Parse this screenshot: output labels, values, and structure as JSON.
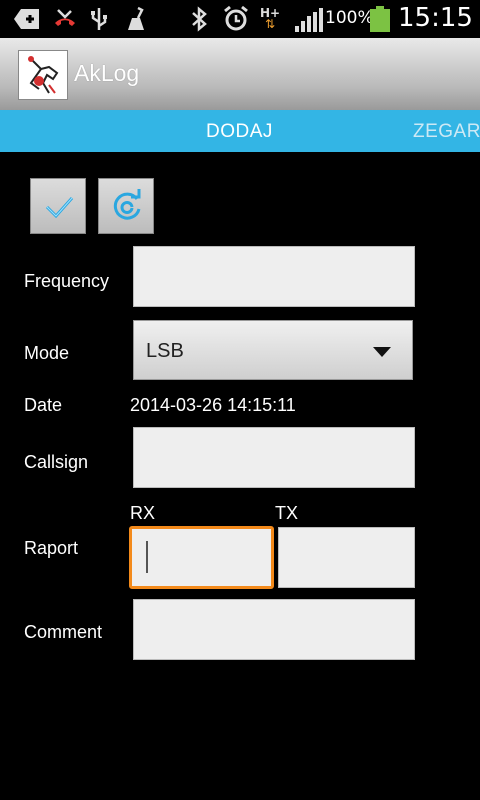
{
  "status_bar": {
    "icons": [
      "add-notification-icon",
      "missed-call-icon",
      "usb-icon",
      "cleaner-icon",
      "bluetooth-icon",
      "alarm-icon",
      "hplus-data-icon",
      "signal-icon",
      "battery-icon"
    ],
    "hplus_label": "H+",
    "battery_percent": "100%",
    "time": "15:15"
  },
  "action_bar": {
    "title": "AkLog"
  },
  "tabs": [
    {
      "label": "DODAJ",
      "active": true
    },
    {
      "label": "ZEGAR",
      "active": false
    }
  ],
  "toolbar": {
    "save_icon": "checkmark-icon",
    "reset_icon": "refresh-icon"
  },
  "form": {
    "frequency_label": "Frequency",
    "frequency_value": "",
    "mode_label": "Mode",
    "mode_value": "LSB",
    "date_label": "Date",
    "date_value": "2014-03-26 14:15:11",
    "callsign_label": "Callsign",
    "callsign_value": "",
    "raport_label": "Raport",
    "rx_label": "RX",
    "tx_label": "TX",
    "rx_value": "",
    "tx_value": "",
    "comment_label": "Comment",
    "comment_value": ""
  },
  "colors": {
    "tab_strip": "#33b5e5",
    "focus_border": "#f38a1b",
    "battery": "#7cc243"
  }
}
